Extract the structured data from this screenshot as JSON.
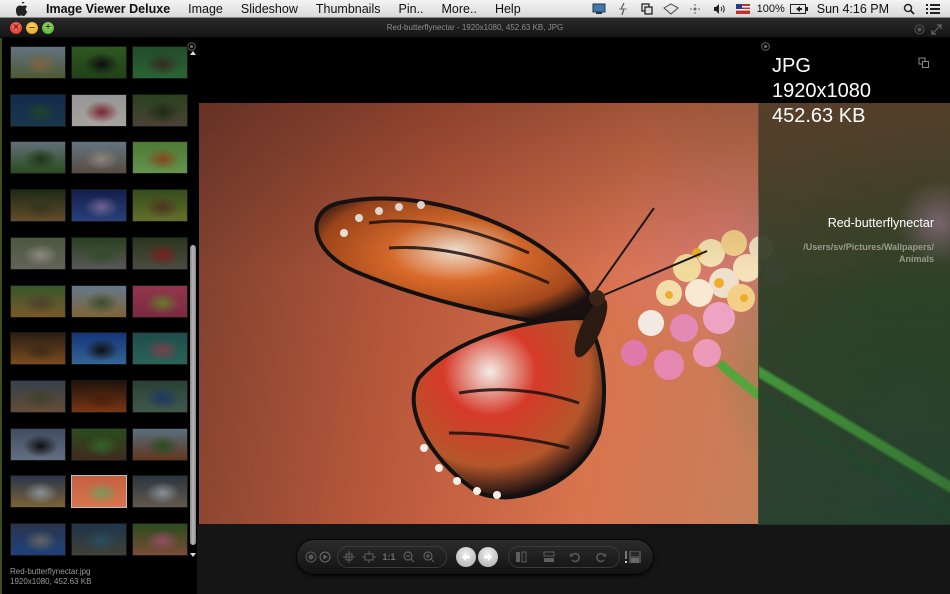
{
  "menubar": {
    "app_name": "Image Viewer Deluxe",
    "menus": [
      "Image",
      "Slideshow",
      "Thumbnails",
      "Pin..",
      "More..",
      "Help"
    ],
    "status": {
      "battery_percent": "100%",
      "clock": "Sun 4:16 PM"
    }
  },
  "window": {
    "title": "Red-butterflynectar - 1920x1080, 452.63 KB, JPG"
  },
  "sidebar": {
    "selected_index": 28,
    "thumbnails": [
      {
        "subject": "giraffe",
        "colors": [
          "#8aa0b0",
          "#6b7b4a",
          "#b08a55"
        ]
      },
      {
        "subject": "butterfly-on-leaf",
        "colors": [
          "#3f7a2e",
          "#2c5a20",
          "#151515"
        ]
      },
      {
        "subject": "green-lizard",
        "colors": [
          "#2f6a3a",
          "#3b8a4a",
          "#4a3a2a"
        ]
      },
      {
        "subject": "sea-turtle",
        "colors": [
          "#1a3a6a",
          "#244d6a",
          "#2d5a3a"
        ]
      },
      {
        "subject": "puppy-in-blanket",
        "colors": [
          "#d0d0d0",
          "#e8e4dc",
          "#aa3344"
        ]
      },
      {
        "subject": "hedgehog",
        "colors": [
          "#3a5a2a",
          "#6a5a4a",
          "#2a3a20"
        ]
      },
      {
        "subject": "horses-in-field",
        "colors": [
          "#8a9aa8",
          "#3a6a2a",
          "#2a4a20"
        ]
      },
      {
        "subject": "meerkats",
        "colors": [
          "#8aa0b0",
          "#7a6a5a",
          "#c0b8a8"
        ]
      },
      {
        "subject": "orange-butterfly",
        "colors": [
          "#6aaa4a",
          "#8acc6a",
          "#c0602a"
        ]
      },
      {
        "subject": "leopard-resting",
        "colors": [
          "#2a3a20",
          "#8a6a3a",
          "#4a4a2a"
        ]
      },
      {
        "subject": "jellyfish",
        "colors": [
          "#1a2a6a",
          "#3a5aaa",
          "#9a8acc"
        ]
      },
      {
        "subject": "bee-eater-bird",
        "colors": [
          "#4a6a2a",
          "#8a9a3a",
          "#6a4a2a"
        ]
      },
      {
        "subject": "koala",
        "colors": [
          "#6a7a5a",
          "#8a8a7a",
          "#c0c0b0"
        ]
      },
      {
        "subject": "elephants",
        "colors": [
          "#3a5a2a",
          "#7a7a7a",
          "#4a6a3a"
        ]
      },
      {
        "subject": "ladybugs",
        "colors": [
          "#3a4a2a",
          "#6a6a5a",
          "#aa2a2a"
        ]
      },
      {
        "subject": "leopard-portrait",
        "colors": [
          "#4a7a3a",
          "#aa7a3a",
          "#6a5a3a"
        ]
      },
      {
        "subject": "lioness",
        "colors": [
          "#8aa8c0",
          "#b08a4a",
          "#5a6a3a"
        ]
      },
      {
        "subject": "gecko",
        "colors": [
          "#cc4a6a",
          "#aa3a5a",
          "#8aaa3a"
        ]
      },
      {
        "subject": "lion",
        "colors": [
          "#3a2a1a",
          "#aa6a2a",
          "#5a3a20"
        ]
      },
      {
        "subject": "manta-ray",
        "colors": [
          "#1a4aaa",
          "#4a8acc",
          "#151515"
        ]
      },
      {
        "subject": "butterfly-on-grass",
        "colors": [
          "#2a6a6a",
          "#3a8a7a",
          "#aa5a6a"
        ]
      },
      {
        "subject": "deer",
        "colors": [
          "#4a5a6a",
          "#8a6a4a",
          "#5a5a3a"
        ]
      },
      {
        "subject": "fiery-bird",
        "colors": [
          "#2a1a10",
          "#aa4a1a",
          "#6a2a10"
        ]
      },
      {
        "subject": "peacock",
        "colors": [
          "#3a5a4a",
          "#5a7a6a",
          "#2a4a8a"
        ]
      },
      {
        "subject": "penguin",
        "colors": [
          "#5a6a8a",
          "#8a9ab0",
          "#151515"
        ]
      },
      {
        "subject": "turkey",
        "colors": [
          "#3a6a2a",
          "#5a3a2a",
          "#4a8a3a"
        ]
      },
      {
        "subject": "horse",
        "colors": [
          "#7a9ab0",
          "#8a4a2a",
          "#3a6a2a"
        ]
      },
      {
        "subject": "dog-in-snow",
        "colors": [
          "#3a4a6a",
          "#aa8a4a",
          "#c0c8d0"
        ]
      },
      {
        "subject": "red-butterfly-nectar",
        "colors": [
          "#c46040",
          "#d8744e",
          "#7a9a5a"
        ]
      },
      {
        "subject": "snow-leopard",
        "colors": [
          "#3a4a5a",
          "#8a7a6a",
          "#c0c8d0"
        ]
      },
      {
        "subject": "cat-with-cap",
        "colors": [
          "#3a4a6a",
          "#2a5aaa",
          "#8a8a8a"
        ]
      },
      {
        "subject": "coral-reef",
        "colors": [
          "#2a4a6a",
          "#5a5a4a",
          "#3a6a8a"
        ]
      },
      {
        "subject": "fawns-in-grass",
        "colors": [
          "#3a6a2a",
          "#aa6a4a",
          "#cc6a8a"
        ]
      }
    ],
    "caption_filename": "Red-butterflynectar.jpg",
    "caption_details": "1920x1080, 452.63 KB"
  },
  "info": {
    "type": "JPG",
    "resolution": "1920x1080",
    "size": "452.63 KB",
    "name": "Red-butterflynectar",
    "path": "/Users/sv/Pictures/Wallpapers/ Animals"
  },
  "toolbar": {
    "actual_size_label": "1:1",
    "buttons": [
      "stop",
      "play",
      "fit-to-window",
      "fit-width",
      "actual-size",
      "zoom-out",
      "zoom-in",
      "previous",
      "next",
      "split-vertical",
      "split-horizontal",
      "rotate-left",
      "rotate-right",
      "save"
    ]
  },
  "image": {
    "subject": "red lacewing butterfly on lantana flowers"
  }
}
